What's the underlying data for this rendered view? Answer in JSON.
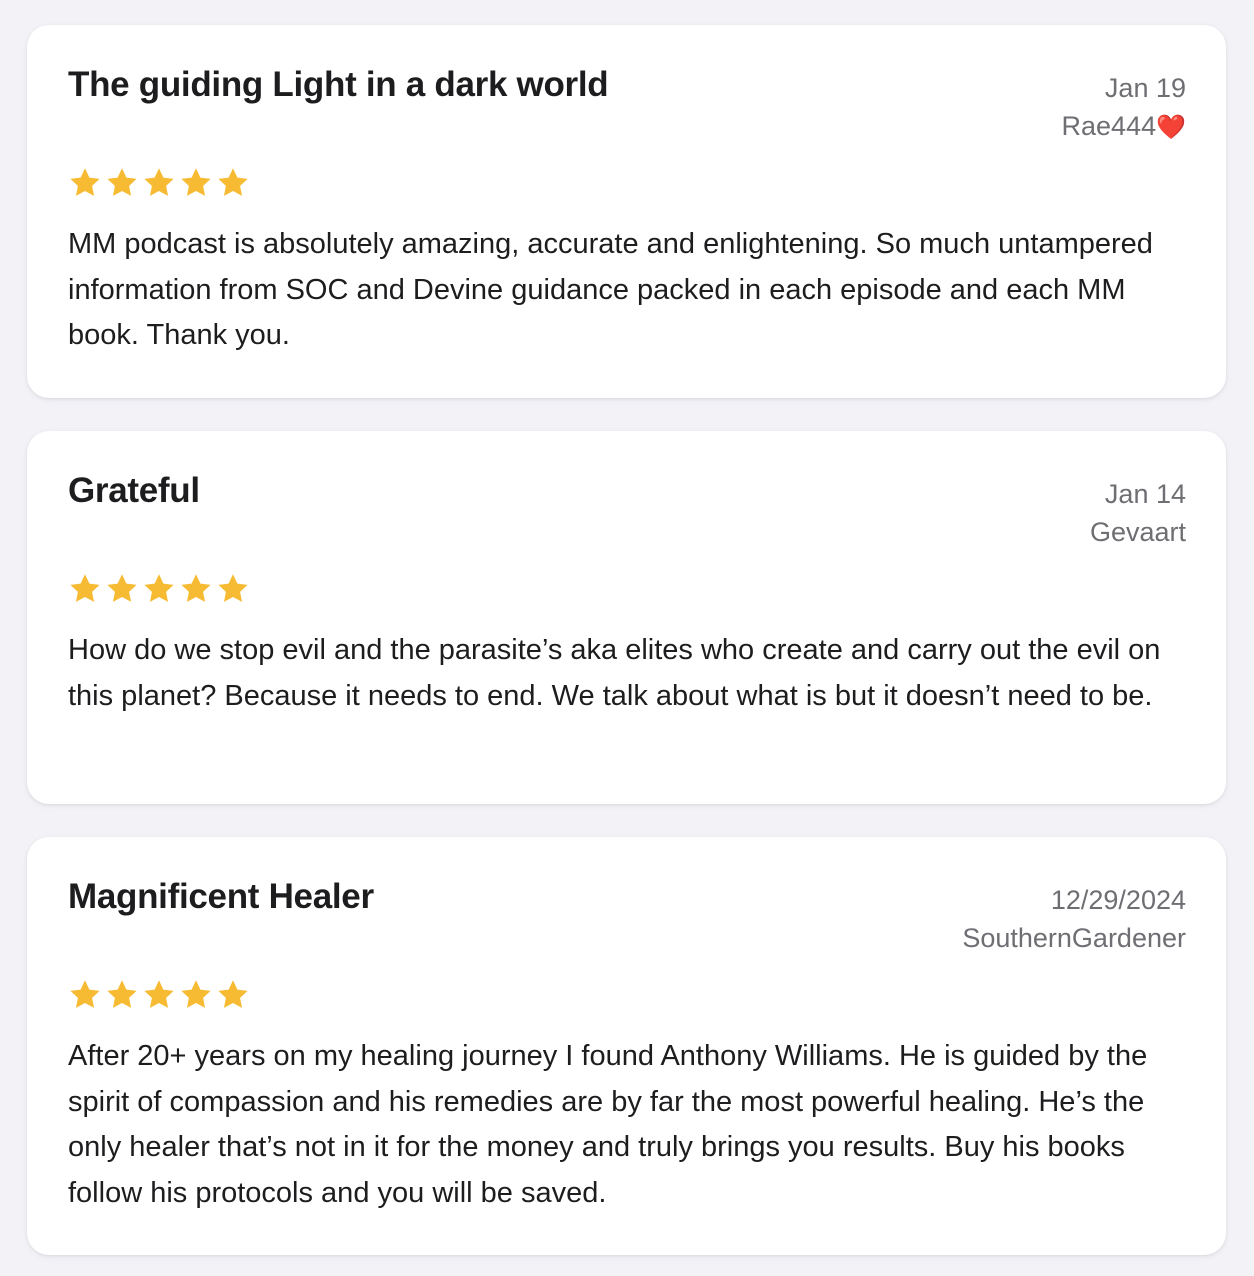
{
  "colors": {
    "background": "#f2f2f7",
    "card": "#ffffff",
    "star": "#f6bb32",
    "title_text": "#1d1d1f",
    "meta_text": "#6e6e73",
    "heart": "#e0332d"
  },
  "reviews": [
    {
      "title": "The guiding Light in a dark world",
      "date": "Jan 19",
      "author": "Rae444",
      "author_emoji": "❤️",
      "rating": 5,
      "body": "MM podcast is absolutely amazing, accurate and enlightening. So much untampered information from SOC and Devine guidance packed in each episode and each MM book. Thank you."
    },
    {
      "title": "Grateful",
      "date": "Jan 14",
      "author": "Gevaart",
      "author_emoji": "",
      "rating": 5,
      "body": "How do we stop evil and the parasite’s aka elites who create and carry out the evil on this planet? Because it needs to end. We talk about what is but it doesn’t need to be."
    },
    {
      "title": "Magnificent Healer",
      "date": "12/29/2024",
      "author": "SouthernGardener",
      "author_emoji": "",
      "rating": 5,
      "body": "After 20+ years on my healing journey I found Anthony Williams. He is guided by the spirit of compassion and his remedies are by far the most powerful healing. He’s the only healer that’s not in it for the money and truly brings you results. Buy his books follow his protocols and you will be saved."
    }
  ]
}
